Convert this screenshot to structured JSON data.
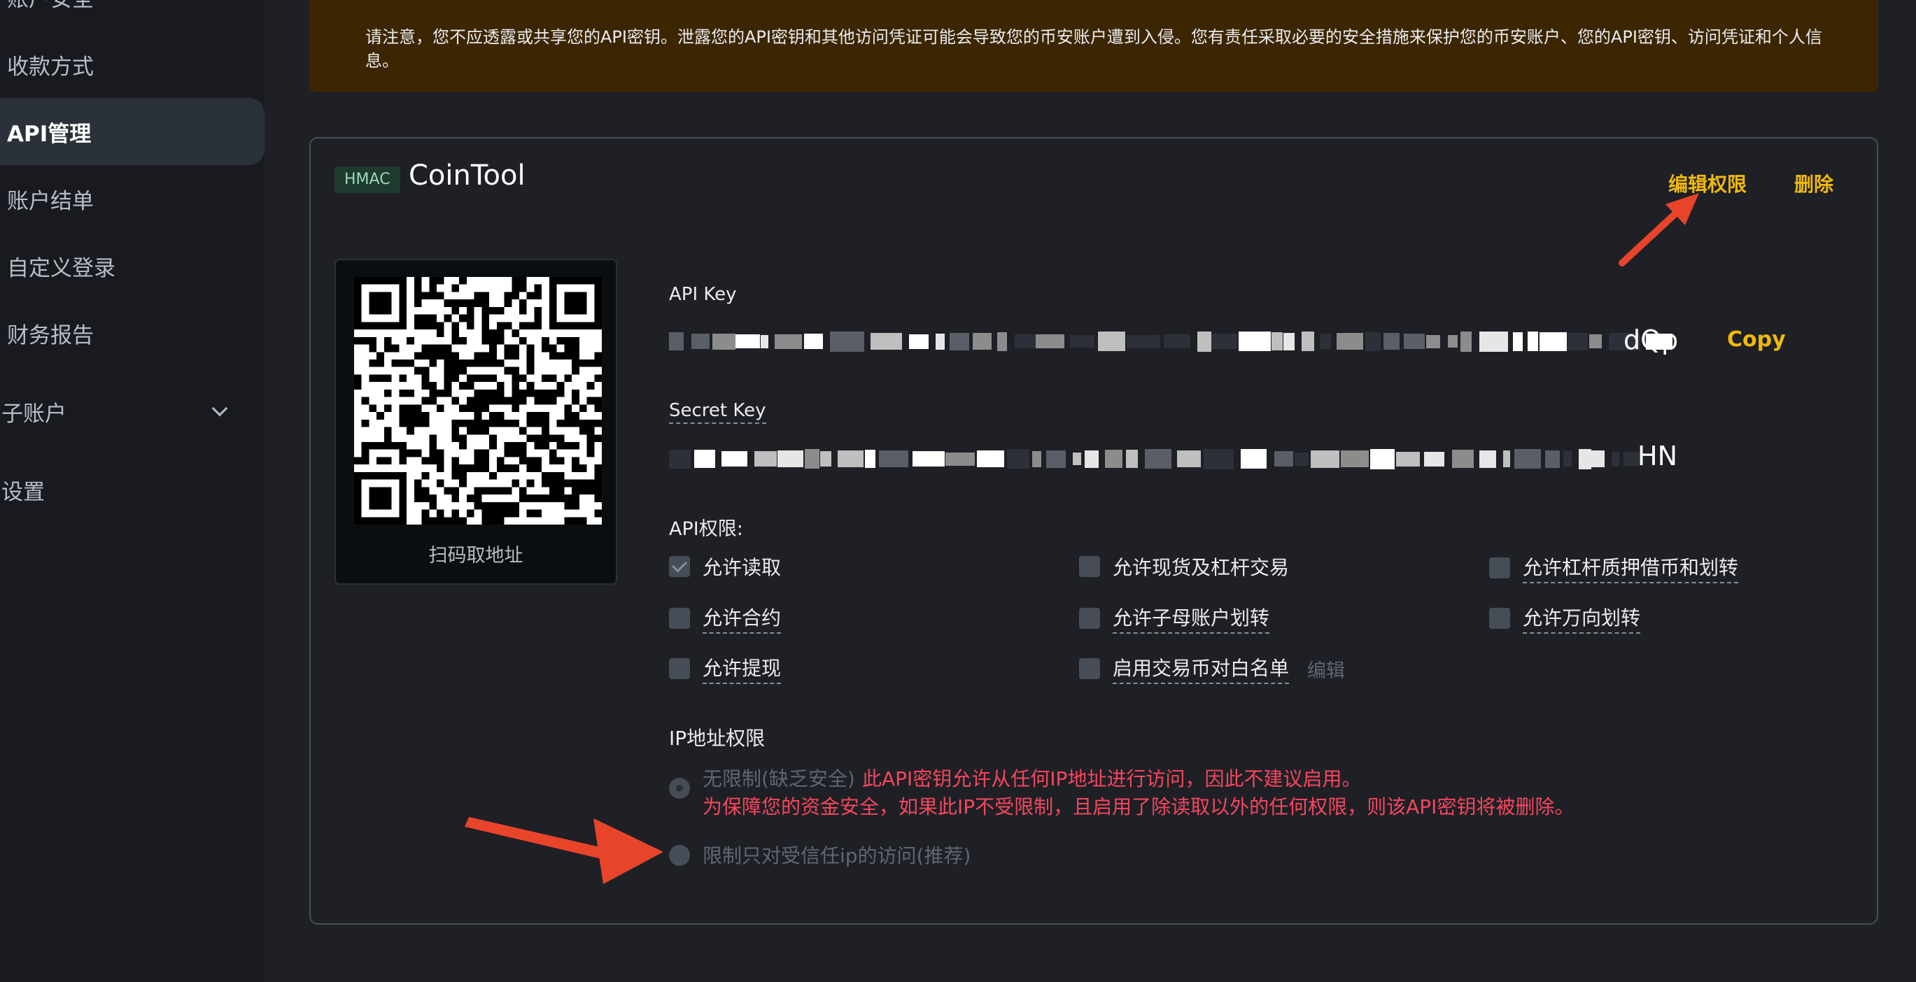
{
  "sidebar": {
    "items": [
      {
        "label": "账户安全"
      },
      {
        "label": "收款方式"
      },
      {
        "label": "API管理"
      },
      {
        "label": "账户结单"
      },
      {
        "label": "自定义登录"
      },
      {
        "label": "财务报告"
      },
      {
        "label": "子账户"
      },
      {
        "label": "设置"
      }
    ]
  },
  "banner": {
    "text": "请注意，您不应透露或共享您的API密钥。泄露您的API密钥和其他访问凭证可能会导致您的币安账户遭到入侵。您有责任采取必要的安全措施来保护您的币安账户、您的API密钥、访问凭证和个人信息。"
  },
  "card": {
    "badge": "HMAC",
    "title": "CoinTool",
    "edit_label": "编辑权限",
    "delete_label": "删除",
    "qr_caption": "扫码取地址",
    "api_key_label": "API Key",
    "api_key_suffix": "dQp",
    "copy_label": "Copy",
    "secret_key_label": "Secret Key",
    "secret_key_suffix": "HN",
    "permissions_title": "API权限:",
    "permissions": [
      {
        "label": "允许读取",
        "checked": true
      },
      {
        "label": "允许现货及杠杆交易",
        "checked": false
      },
      {
        "label": "允许杠杆质押借币和划转",
        "checked": false
      },
      {
        "label": "允许合约",
        "checked": false
      },
      {
        "label": "允许子母账户划转",
        "checked": false
      },
      {
        "label": "允许万向划转",
        "checked": false
      },
      {
        "label": "允许提现",
        "checked": false
      },
      {
        "label": "启用交易币对白名单",
        "checked": false
      }
    ],
    "whitelist_edit_label": "编辑",
    "ip_title": "IP地址权限",
    "ip_unrestricted_label": "无限制(缺乏安全)",
    "ip_warning_1": "此API密钥允许从任何IP地址进行访问，因此不建议启用。",
    "ip_warning_2": "为保障您的资金安全，如果此IP不受限制，且启用了除读取以外的任何权限，则该API密钥将被删除。",
    "ip_restricted_label": "限制只对受信任ip的访问(推荐)"
  },
  "colors": {
    "accent": "#f0b90b",
    "warning_red": "#f6465d",
    "annotation_arrow": "#e8442a"
  }
}
